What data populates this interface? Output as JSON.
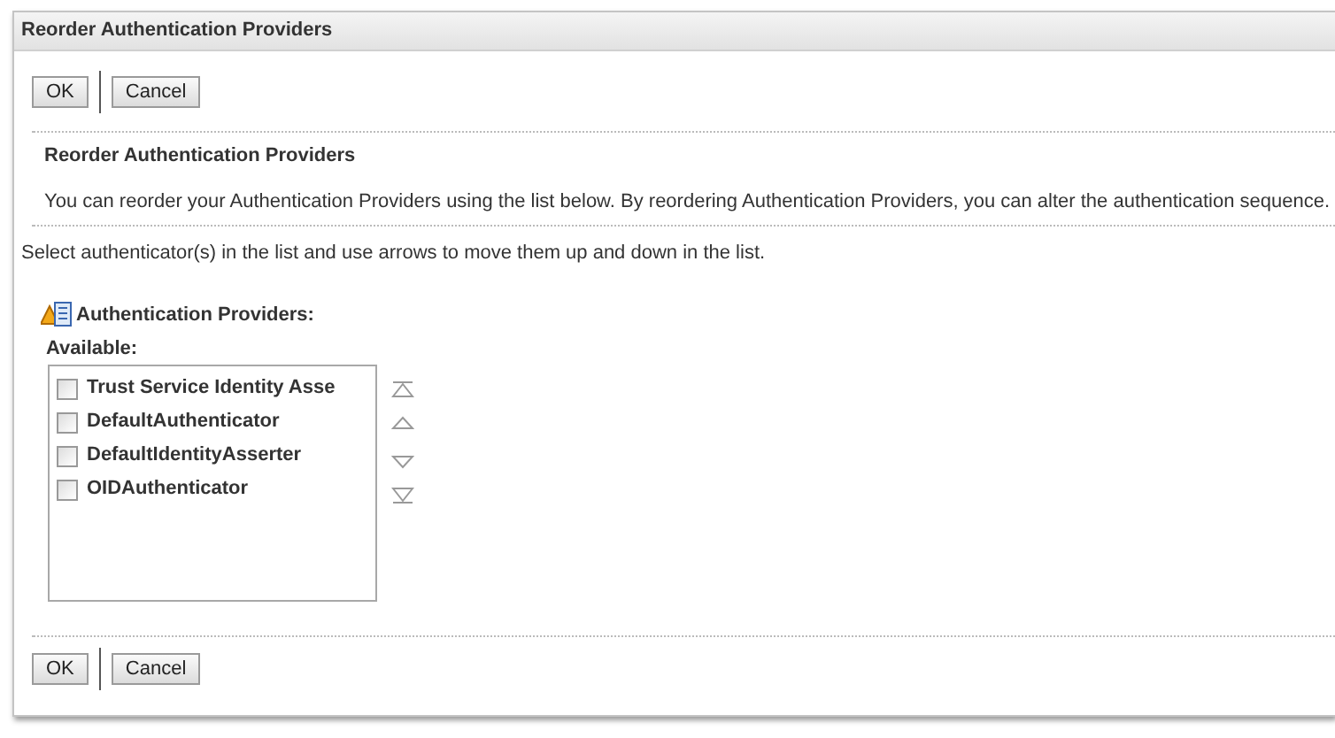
{
  "window": {
    "title": "Reorder Authentication Providers"
  },
  "top_buttons": [
    "OK",
    "Cancel"
  ],
  "section": {
    "heading": "Reorder Authentication Providers",
    "description": "You can reorder your Authentication Providers using the list below. By reordering Authentication Providers, you can alter the authentication sequence."
  },
  "instruction": "Select authenticator(s) in the list and use arrows to move them up and down in the list.",
  "providers": {
    "label": "Authentication Providers:",
    "list_label": "Available:",
    "items": [
      {
        "label": "Trust Service Identity Asse",
        "checked": false
      },
      {
        "label": "DefaultAuthenticator",
        "checked": false
      },
      {
        "label": "DefaultIdentityAsserter",
        "checked": false
      },
      {
        "label": "OIDAuthenticator",
        "checked": false
      }
    ]
  },
  "bottom_buttons": [
    "OK",
    "Cancel"
  ]
}
